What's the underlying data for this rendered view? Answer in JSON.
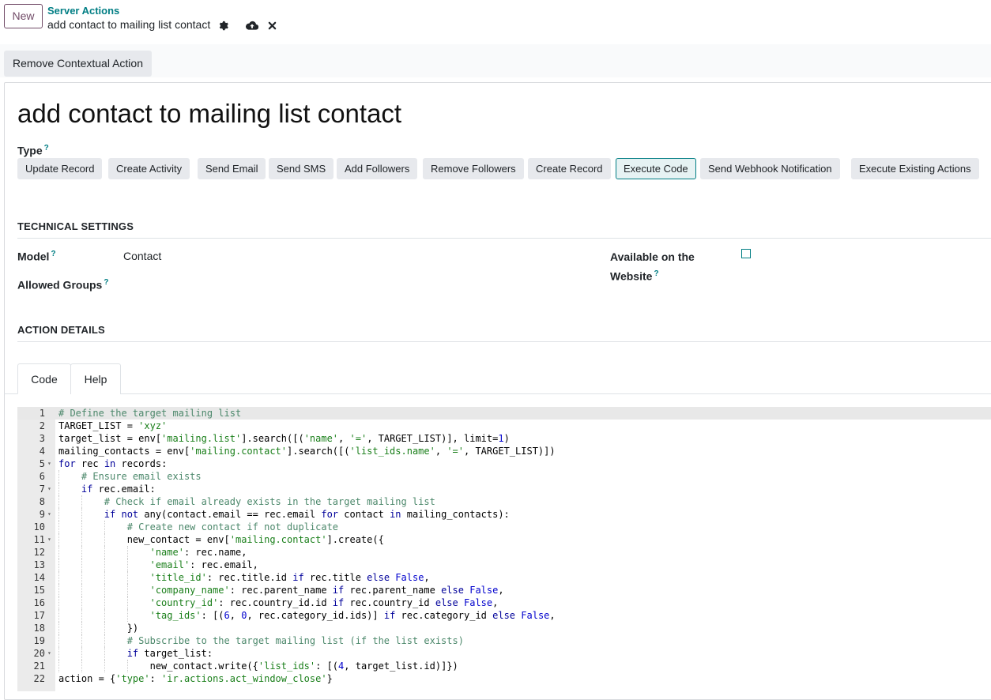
{
  "topbar": {
    "new_label": "New",
    "breadcrumb": "Server Actions",
    "record_name": "add contact to mailing list contact"
  },
  "control": {
    "remove_contextual_label": "Remove Contextual Action"
  },
  "form": {
    "title": "add contact to mailing list contact",
    "type_label": "Type",
    "help_mark": "?",
    "type_options": [
      {
        "label": "Update Record"
      },
      {
        "label": "Create Activity"
      },
      {
        "label": "Send Email"
      },
      {
        "label": "Send SMS"
      },
      {
        "label": "Add Followers"
      },
      {
        "label": "Remove Followers"
      },
      {
        "label": "Create Record"
      },
      {
        "label": "Execute Code"
      },
      {
        "label": "Send Webhook Notification"
      },
      {
        "label": "Execute Existing Actions"
      }
    ],
    "selected_type": "Execute Code",
    "technical_settings": "TECHNICAL SETTINGS",
    "model_label": "Model",
    "model_value": "Contact",
    "allowed_groups_label": "Allowed Groups",
    "website_label_line1": "Available on the",
    "website_label_line2": "Website",
    "website_checked": false,
    "action_details": "ACTION DETAILS",
    "tabs": [
      {
        "label": "Code"
      },
      {
        "label": "Help"
      }
    ],
    "active_tab": "Code"
  },
  "code_lines": [
    [
      [
        "c",
        "# Define the target mailing list"
      ]
    ],
    [
      [
        "p",
        "TARGET_LIST = "
      ],
      [
        "s",
        "'xyz'"
      ]
    ],
    [
      [
        "p",
        "target_list = env["
      ],
      [
        "s",
        "'mailing.list'"
      ],
      [
        "p",
        "].search([("
      ],
      [
        "s",
        "'name'"
      ],
      [
        "p",
        ", "
      ],
      [
        "s",
        "'='"
      ],
      [
        "p",
        ", TARGET_LIST)], limit="
      ],
      [
        "n",
        "1"
      ],
      [
        "p",
        ")"
      ]
    ],
    [
      [
        "p",
        "mailing_contacts = env["
      ],
      [
        "s",
        "'mailing.contact'"
      ],
      [
        "p",
        "].search([("
      ],
      [
        "s",
        "'list_ids.name'"
      ],
      [
        "p",
        ", "
      ],
      [
        "s",
        "'='"
      ],
      [
        "p",
        ", TARGET_LIST)])"
      ]
    ],
    [
      [
        "k",
        "for"
      ],
      [
        "p",
        " rec "
      ],
      [
        "k",
        "in"
      ],
      [
        "p",
        " records:"
      ]
    ],
    [
      [
        "p",
        "    "
      ],
      [
        "c",
        "# Ensure email exists"
      ]
    ],
    [
      [
        "p",
        "    "
      ],
      [
        "k",
        "if"
      ],
      [
        "p",
        " rec.email:"
      ]
    ],
    [
      [
        "p",
        "        "
      ],
      [
        "c",
        "# Check if email already exists in the target mailing list"
      ]
    ],
    [
      [
        "p",
        "        "
      ],
      [
        "k",
        "if not"
      ],
      [
        "p",
        " any(contact.email == rec.email "
      ],
      [
        "k",
        "for"
      ],
      [
        "p",
        " contact "
      ],
      [
        "k",
        "in"
      ],
      [
        "p",
        " mailing_contacts):"
      ]
    ],
    [
      [
        "p",
        "            "
      ],
      [
        "c",
        "# Create new contact if not duplicate"
      ]
    ],
    [
      [
        "p",
        "            new_contact = env["
      ],
      [
        "s",
        "'mailing.contact'"
      ],
      [
        "p",
        "].create({"
      ]
    ],
    [
      [
        "p",
        "                "
      ],
      [
        "s",
        "'name'"
      ],
      [
        "p",
        ": rec.name,"
      ]
    ],
    [
      [
        "p",
        "                "
      ],
      [
        "s",
        "'email'"
      ],
      [
        "p",
        ": rec.email,"
      ]
    ],
    [
      [
        "p",
        "                "
      ],
      [
        "s",
        "'title_id'"
      ],
      [
        "p",
        ": rec.title.id "
      ],
      [
        "k",
        "if"
      ],
      [
        "p",
        " rec.title "
      ],
      [
        "k",
        "else"
      ],
      [
        "p",
        " "
      ],
      [
        "n",
        "False"
      ],
      [
        "p",
        ","
      ]
    ],
    [
      [
        "p",
        "                "
      ],
      [
        "s",
        "'company_name'"
      ],
      [
        "p",
        ": rec.parent_name "
      ],
      [
        "k",
        "if"
      ],
      [
        "p",
        " rec.parent_name "
      ],
      [
        "k",
        "else"
      ],
      [
        "p",
        " "
      ],
      [
        "n",
        "False"
      ],
      [
        "p",
        ","
      ]
    ],
    [
      [
        "p",
        "                "
      ],
      [
        "s",
        "'country_id'"
      ],
      [
        "p",
        ": rec.country_id.id "
      ],
      [
        "k",
        "if"
      ],
      [
        "p",
        " rec.country_id "
      ],
      [
        "k",
        "else"
      ],
      [
        "p",
        " "
      ],
      [
        "n",
        "False"
      ],
      [
        "p",
        ","
      ]
    ],
    [
      [
        "p",
        "                "
      ],
      [
        "s",
        "'tag_ids'"
      ],
      [
        "p",
        ": [("
      ],
      [
        "n",
        "6"
      ],
      [
        "p",
        ", "
      ],
      [
        "n",
        "0"
      ],
      [
        "p",
        ", rec.category_id.ids)] "
      ],
      [
        "k",
        "if"
      ],
      [
        "p",
        " rec.category_id "
      ],
      [
        "k",
        "else"
      ],
      [
        "p",
        " "
      ],
      [
        "n",
        "False"
      ],
      [
        "p",
        ","
      ]
    ],
    [
      [
        "p",
        "            })"
      ]
    ],
    [
      [
        "p",
        "            "
      ],
      [
        "c",
        "# Subscribe to the target mailing list (if the list exists)"
      ]
    ],
    [
      [
        "p",
        "            "
      ],
      [
        "k",
        "if"
      ],
      [
        "p",
        " target_list:"
      ]
    ],
    [
      [
        "p",
        "                new_contact.write({"
      ],
      [
        "s",
        "'list_ids'"
      ],
      [
        "p",
        ": [("
      ],
      [
        "n",
        "4"
      ],
      [
        "p",
        ", target_list.id)]})"
      ]
    ],
    [
      [
        "p",
        "action = {"
      ],
      [
        "s",
        "'type'"
      ],
      [
        "p",
        ": "
      ],
      [
        "s",
        "'ir.actions.act_window_close'"
      ],
      [
        "p",
        "}"
      ]
    ]
  ],
  "fold_lines": [
    5,
    7,
    9,
    11,
    20
  ],
  "colors": {
    "accent": "#017e84",
    "brand": "#714b67",
    "comment": "#4c886b",
    "string": "#1a7f1a",
    "keyword": "#00009a",
    "number": "#0000cd"
  }
}
